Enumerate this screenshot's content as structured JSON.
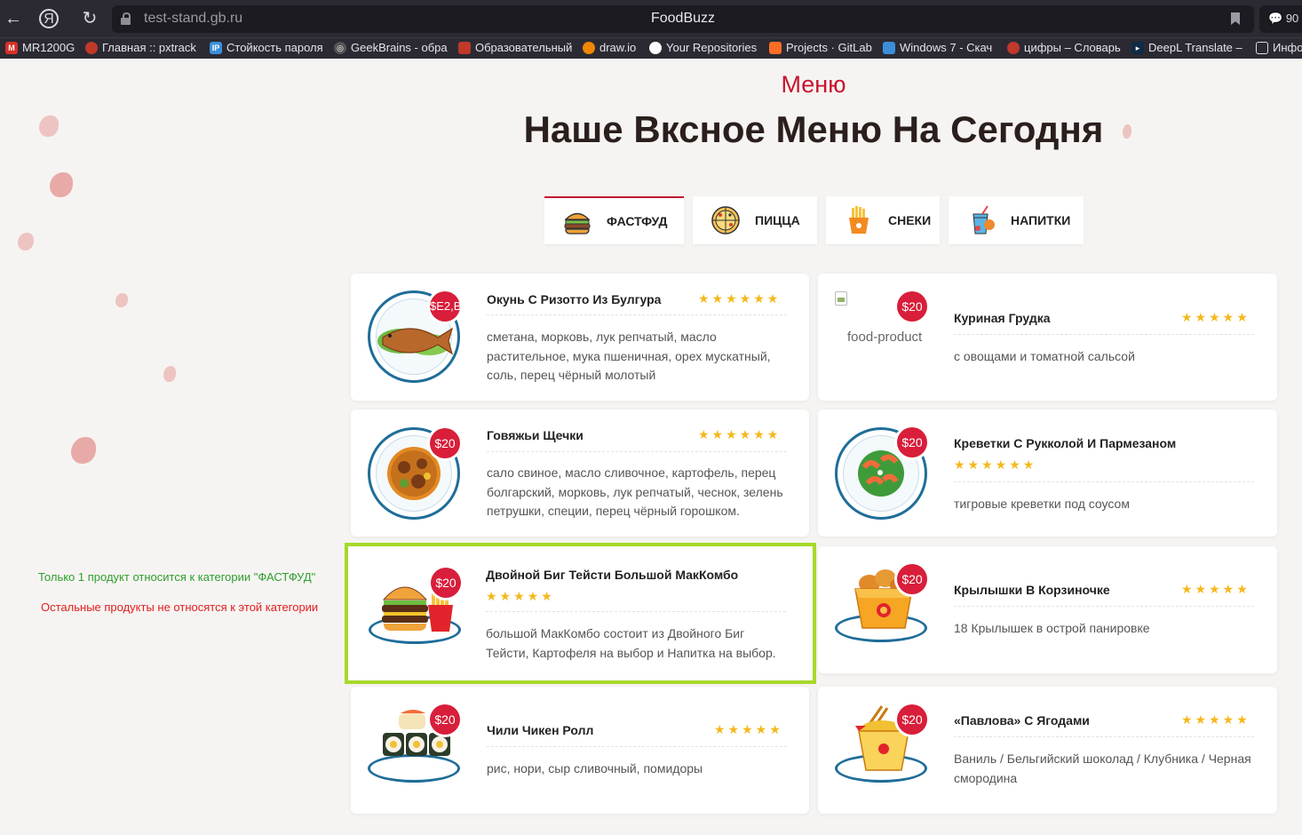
{
  "browser": {
    "url": "test-stand.gb.ru",
    "title": "FoodBuzz",
    "ext_badge": "90",
    "bookmarks": [
      {
        "label": "MR1200G",
        "icon": "gmail-icon",
        "color": "#d93025"
      },
      {
        "label": "Главная :: pxtrack",
        "icon": "car-icon",
        "color": "#c0392b"
      },
      {
        "label": "Стойкость пароля",
        "icon": "ip-icon",
        "color": "#3b8fd9"
      },
      {
        "label": "GeekBrains - обра",
        "icon": "geekbrains-icon",
        "color": "#555555"
      },
      {
        "label": "Образовательный",
        "icon": "education-icon",
        "color": "#c0392b"
      },
      {
        "label": "draw.io",
        "icon": "drawio-icon",
        "color": "#f08705"
      },
      {
        "label": "Your Repositories",
        "icon": "github-icon",
        "color": "#ffffff"
      },
      {
        "label": "Projects · GitLab",
        "icon": "gitlab-icon",
        "color": "#fc6d26"
      },
      {
        "label": "Windows 7 - Скач",
        "icon": "windows-icon",
        "color": "#3b8fd9"
      },
      {
        "label": "цифры – Словарь",
        "icon": "dictionary-icon",
        "color": "#c0392b"
      },
      {
        "label": "DeepL Translate –",
        "icon": "deepl-icon",
        "color": "#0f2b46"
      },
      {
        "label": "Инфо",
        "icon": "document-icon",
        "color": "#dddddd"
      }
    ]
  },
  "section": {
    "label": "Меню",
    "title": "Наше Вксное Меню На Сегодня"
  },
  "tabs": [
    {
      "label": "ФАСТФУД",
      "icon": "burger-icon",
      "active": true
    },
    {
      "label": "ПИЦЦА",
      "icon": "pizza-icon",
      "active": false
    },
    {
      "label": "СНЕКИ",
      "icon": "fries-icon",
      "active": false
    },
    {
      "label": "НАПИТКИ",
      "icon": "drink-icon",
      "active": false
    }
  ],
  "products": [
    {
      "name": "Окунь С Ризотто Из Булгура",
      "price": "$E2,B",
      "rating": 6,
      "description": "сметана, морковь, лук репчатый, масло растительное, мука пшеничная, орех мускатный, соль, перец чёрный молотый",
      "image": "fish-plate-icon"
    },
    {
      "name": "Куриная Грудка",
      "price": "$20",
      "rating": 5,
      "description": "с овощами и томатной сальсой",
      "image": "broken-image-icon",
      "alt": "food-product"
    },
    {
      "name": "Говяжьи Щечки",
      "price": "$20",
      "rating": 6,
      "description": "сало свиное, масло сливочное, картофель, перец болгарский, морковь, лук репчатый, чеснок, зелень петрушки, специи, перец чёрный горошком.",
      "image": "stew-plate-icon"
    },
    {
      "name": "Креветки С Рукколой И Пармезаном",
      "price": "$20",
      "rating": 6,
      "description": "тигровые креветки под соусом",
      "image": "shrimp-salad-icon"
    },
    {
      "name": "Двойной Биг Тейсти Большой МакКомбо",
      "price": "$20",
      "rating": 5,
      "description": "большой МакКомбо состоит из Двойного Биг Тейсти, Картофеля на выбор и Напитка на выбор.",
      "image": "burger-combo-icon"
    },
    {
      "name": "Крылышки В Корзиночке",
      "price": "$20",
      "rating": 5,
      "description": "18 Крылышек в острой панировке",
      "image": "wings-basket-icon"
    },
    {
      "name": "Чили Чикен Ролл",
      "price": "$20",
      "rating": 5,
      "description": "рис, нори, сыр сливочный, помидоры",
      "image": "sushi-roll-icon"
    },
    {
      "name": "«Павлова» С Ягодами",
      "price": "$20",
      "rating": 5,
      "description": "Ваниль / Бельгийский шоколад / Клубника / Черная смородина",
      "image": "noodle-box-icon"
    }
  ],
  "annotations": {
    "green": "Только 1 продукт относится к категории \"ФАСТФУД\"",
    "red": "Остальные продукты не относятся к этой категории",
    "green_color": "#2e9e2e",
    "red_color": "#e02020",
    "highlight_color": "#a6d92a"
  }
}
